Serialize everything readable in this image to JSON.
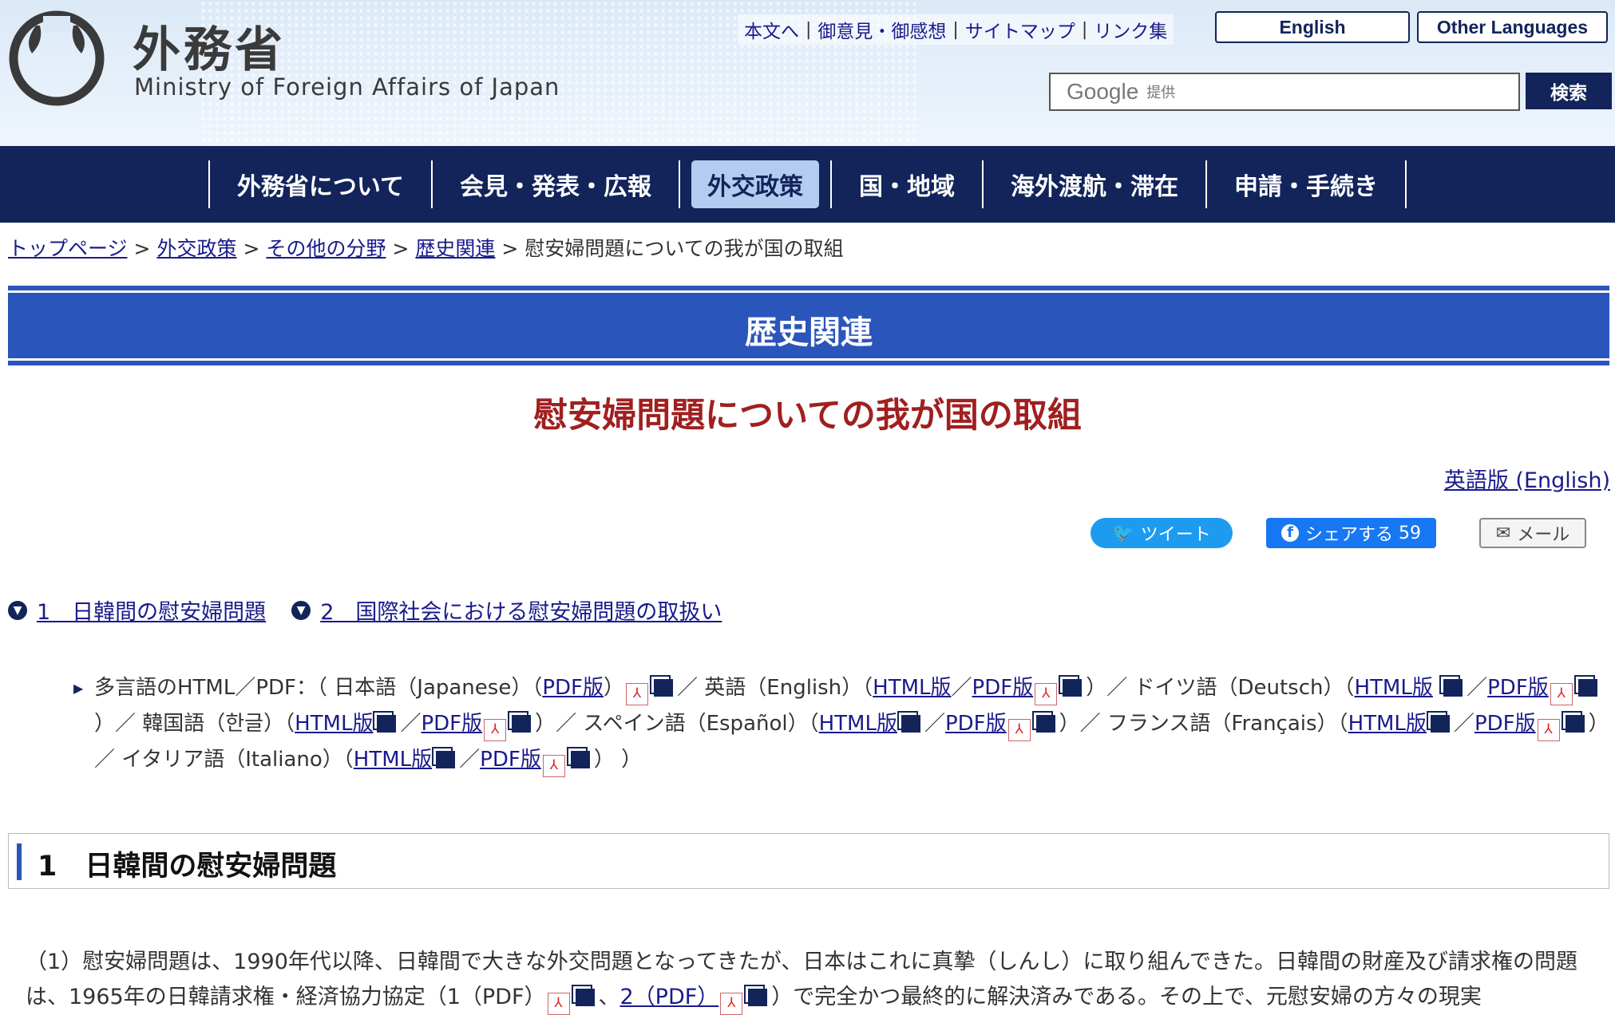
{
  "header": {
    "logo_jp": "外務省",
    "logo_en": "Ministry of Foreign Affairs of Japan",
    "util_links": [
      "本文へ",
      "御意見・御感想",
      "サイトマップ",
      "リンク集"
    ],
    "english_button": "English",
    "other_languages_button": "Other Languages",
    "search_brand": "Google",
    "search_provider": "提供",
    "search_button": "検索"
  },
  "nav": {
    "items": [
      "外務省について",
      "会見・発表・広報",
      "外交政策",
      "国・地域",
      "海外渡航・滞在",
      "申請・手続き"
    ],
    "active": "外交政策"
  },
  "breadcrumb": {
    "links": [
      "トップページ",
      "外交政策",
      "その他の分野",
      "歴史関連"
    ],
    "current": "慰安婦問題についての我が国の取組",
    "separator": ">"
  },
  "banner_title": "歴史関連",
  "page_title": "慰安婦問題についての我が国の取組",
  "english_version_link": "英語版 (English)",
  "share": {
    "tweet": "ツイート",
    "facebook": "シェアする",
    "facebook_count": "59",
    "mail": "メール"
  },
  "anchors": [
    "1　日韓間の慰安婦問題",
    "2　国際社会における慰安婦問題の取扱い"
  ],
  "multilang": {
    "prefix": "多言語のHTML／PDF：（ 日本語（Japanese）（",
    "pdf": "PDF版",
    "html": "HTML版",
    "english": "英語（English）（",
    "german": "ドイツ語（Deutsch）（",
    "korean": "韓国語（한글）（",
    "spanish": "スペイン語（Español）（",
    "french": "フランス語（Français）（",
    "italian": "イタリア語（Italiano）（",
    "slash": "／",
    "close": "）",
    "sep": "）／ ",
    "end": "）  ）"
  },
  "section1_title": "1　日韓間の慰安婦問題",
  "paragraph1": {
    "num": "（1）",
    "text": "慰安婦問題は、1990年代以降、日韓間で大きな外交問題となってきたが、日本はこれに真摯（しんし）に取り組んできた。日韓間の財産及び請求権の問題は、1965年の日韓請求権・経済協力協定（1（PDF）",
    "link2": "2（PDF）",
    "text2": "）で完全かつ最終的に解決済みである。その上で、元慰安婦の方々の現実"
  }
}
